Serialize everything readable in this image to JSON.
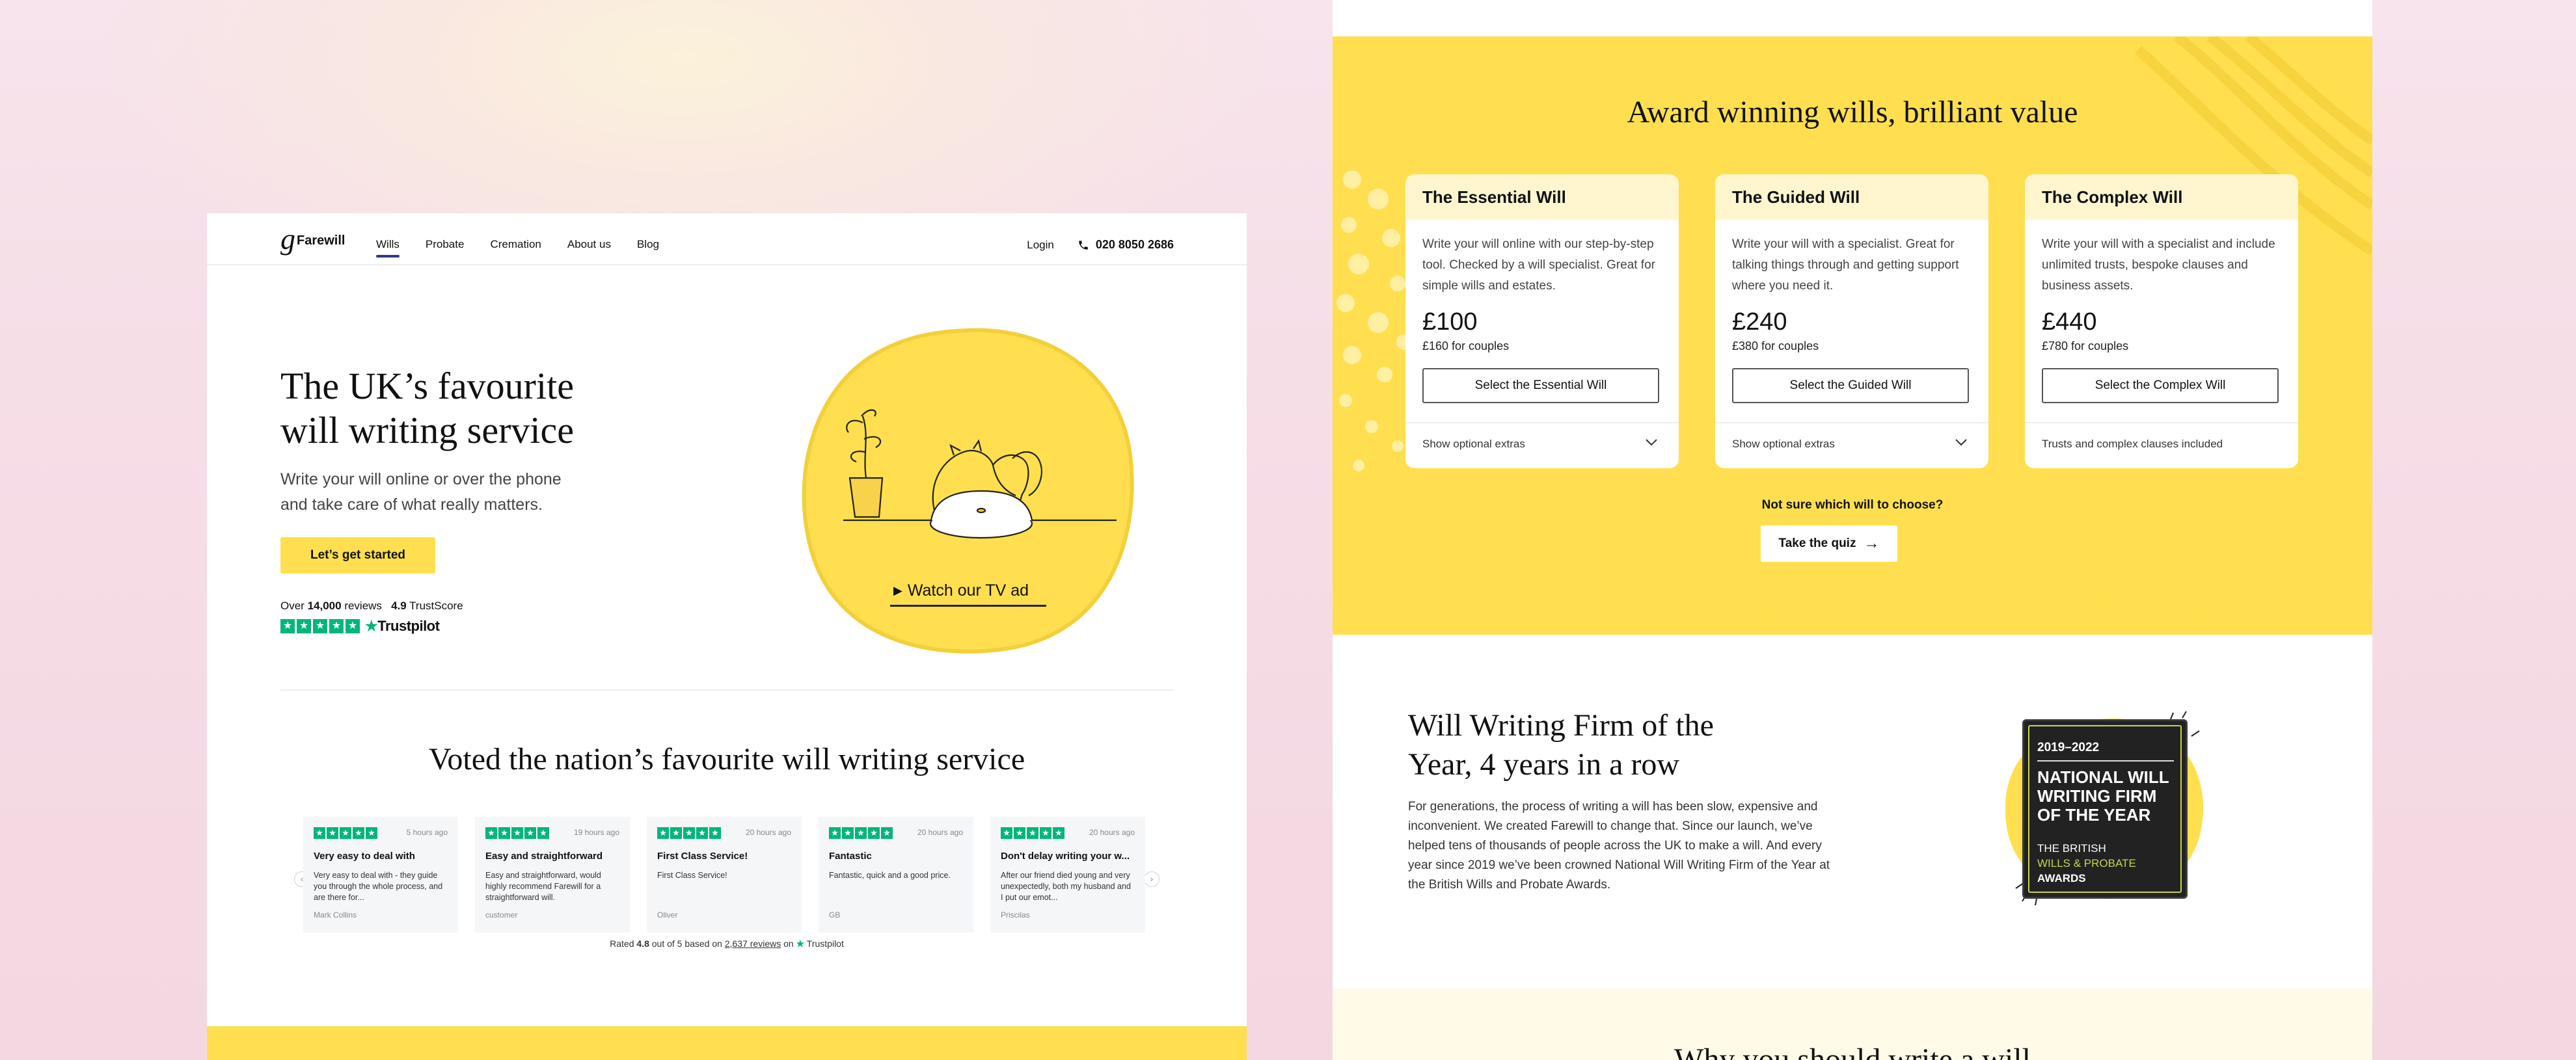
{
  "colors": {
    "brand_yellow": "#ffdf4f",
    "trustpilot_green": "#00b67a",
    "nav_active": "#33368c",
    "badge_lime": "#c8d54a"
  },
  "left_page": {
    "nav": {
      "logo_mark": "g",
      "logo_text": "Farewill",
      "links": [
        "Wills",
        "Probate",
        "Cremation",
        "About us",
        "Blog"
      ],
      "active_link": "Wills",
      "login": "Login",
      "phone": "020 8050 2686"
    },
    "hero": {
      "title_line1": "The UK’s favourite",
      "title_line2": "will writing service",
      "subtitle_line1": "Write your will online or over the phone",
      "subtitle_line2": "and take care of what really matters.",
      "cta": "Let’s get started",
      "reviews_prefix": "Over",
      "reviews_count": "14,000",
      "reviews_suffix": "reviews",
      "trust_score": "4.9",
      "trust_score_label": "TrustScore",
      "trustpilot": "Trustpilot",
      "watch_label": "Watch our TV ad"
    },
    "reviews_section": {
      "title": "Voted the nation’s favourite will writing service",
      "cards": [
        {
          "time": "5 hours ago",
          "title": "Very easy to deal with",
          "body": "Very easy to deal with - they guide you through the whole process, and are there for...",
          "name": "Mark Collins"
        },
        {
          "time": "19 hours ago",
          "title": "Easy and straightforward",
          "body": "Easy and straightforward, would highly recommend Farewill for a straightforward will.",
          "name": "customer"
        },
        {
          "time": "20 hours ago",
          "title": "First Class Service!",
          "body": "First Class Service!",
          "name": "Oliver"
        },
        {
          "time": "20 hours ago",
          "title": "Fantastic",
          "body": "Fantastic, quick and a good price.",
          "name": "GB"
        },
        {
          "time": "20 hours ago",
          "title": "Don't delay writing your w...",
          "body": "After our friend died young and very unexpectedly, both my husband and I put our emot...",
          "name": "Priscilas"
        }
      ],
      "rated_prefix": "Rated",
      "rated_value": "4.8",
      "rated_mid": "out of 5 based on",
      "rated_count": "2,637 reviews",
      "rated_on": "on",
      "rated_brand": "Trustpilot"
    }
  },
  "right_page": {
    "pricing": {
      "title": "Award winning wills, brilliant value",
      "cards": [
        {
          "name": "The Essential Will",
          "desc": "Write your will online with our step-by-step tool. Checked by a will specialist. Great for simple wills and estates.",
          "price": "£100",
          "couples": "£160 for couples",
          "button": "Select the Essential Will",
          "footer": "Show optional extras"
        },
        {
          "name": "The Guided Will",
          "desc": "Write your will with a specialist. Great for talking things through and getting support where you need it.",
          "price": "£240",
          "couples": "£380 for couples",
          "button": "Select the Guided Will",
          "footer": "Show optional extras"
        },
        {
          "name": "The Complex Will",
          "desc": "Write your will with a specialist and include unlimited trusts, bespoke clauses and business assets.",
          "price": "£440",
          "couples": "£780 for couples",
          "button": "Select the Complex Will",
          "footer": "Trusts and complex clauses included"
        }
      ],
      "not_sure": "Not sure which will to choose?",
      "quiz": "Take the quiz"
    },
    "award": {
      "title_line1": "Will Writing Firm of the",
      "title_line2": "Year, 4 years in a row",
      "body": "For generations, the process of writing a will has been slow, expensive and inconvenient. We created Farewill to change that. Since our launch, we’ve helped tens of thousands of people across the UK to make a will. And every year since 2019 we’ve been crowned National Will Writing Firm of the Year at the British Wills and Probate Awards.",
      "badge_years": "2019–2022",
      "badge_main": "NATIONAL WILL WRITING FIRM OF THE YEAR",
      "badge_brit1": "THE BRITISH",
      "badge_brit2": "WILLS & PROBATE",
      "badge_brit3": "AWARDS"
    },
    "next_section_title": "Why you should write a will"
  }
}
